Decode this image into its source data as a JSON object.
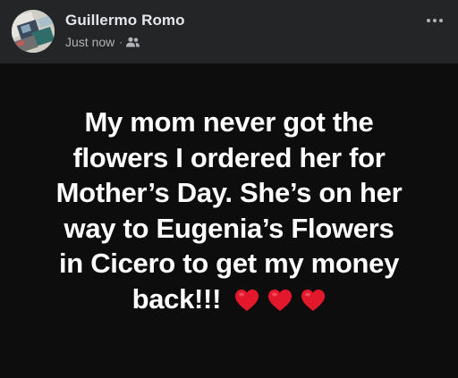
{
  "post": {
    "author": "Guillermo Romo",
    "timestamp": "Just now",
    "separator": "·",
    "audience_icon": "friends-icon",
    "more_icon": "more-options-icon",
    "text_lines": [
      "My mom never got the",
      "flowers I ordered her for",
      "Mother’s Day. She’s on her",
      "way to Eugenia’s Flowers",
      "in Cicero to get my money",
      "back!!!"
    ],
    "emoji": [
      "❤️",
      "❤️",
      "❤️"
    ],
    "colors": {
      "header_bg": "#242526",
      "body_bg": "#0d0d0d",
      "text": "#ffffff",
      "name": "#e4e6eb",
      "meta": "#b0b3b8",
      "heart": "#e3182d"
    }
  }
}
